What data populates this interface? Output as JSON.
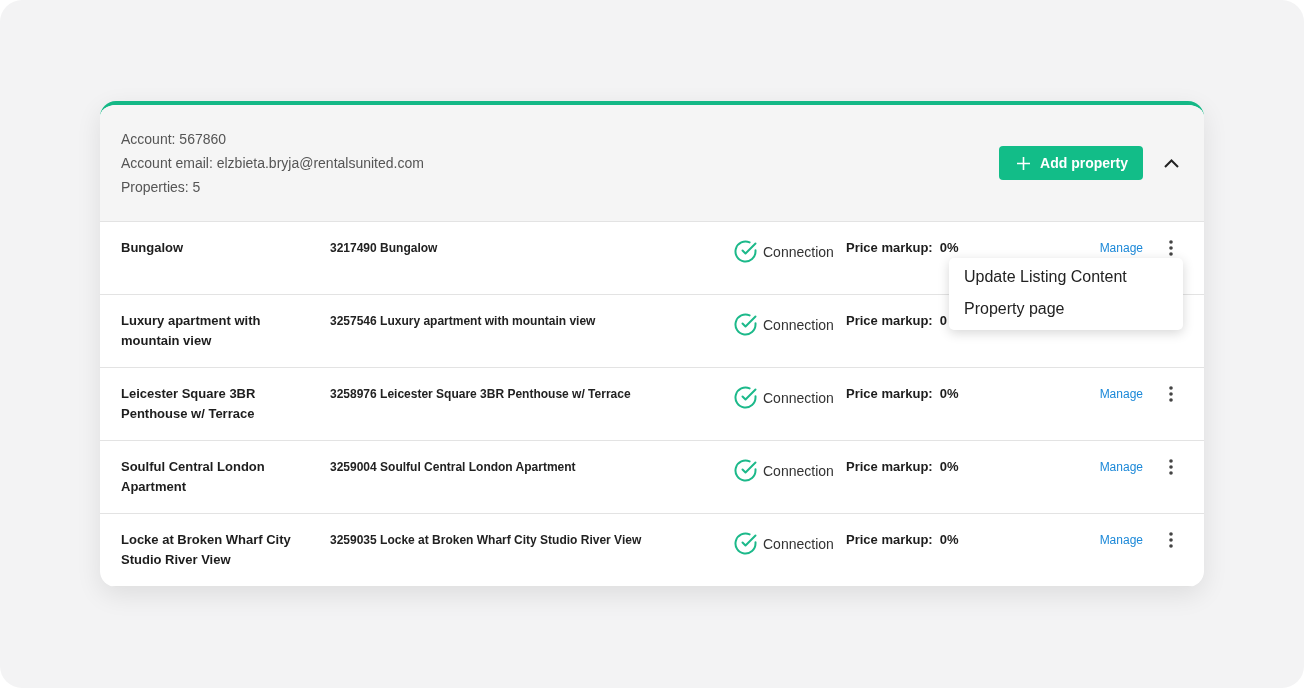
{
  "account": {
    "lines": [
      "Account: 567860",
      "Account email: elzbieta.bryja@rentalsunited.com",
      "Properties: 5"
    ],
    "add_button": "Add property",
    "expanded": true
  },
  "properties": [
    {
      "name": "Bungalow",
      "listing": "3217490 Bungalow",
      "connection": {
        "label": "Connection",
        "connected": true
      },
      "markup_label": "Price markup:",
      "markup_value": "0%",
      "manage": "Manage",
      "menu": {
        "items": [
          "Update Listing Content",
          "Property page"
        ]
      }
    },
    {
      "name": "Luxury apartment with mountain view",
      "listing": "3257546 Luxury apartment with mountain view",
      "connection": {
        "label": "Connection",
        "connected": true
      },
      "markup_label": "Price markup:",
      "markup_value": "0"
    },
    {
      "name": "Leicester Square 3BR Penthouse w/ Terrace",
      "listing": "3258976 Leicester Square 3BR Penthouse w/ Terrace",
      "connection": {
        "label": "Connection",
        "connected": true
      },
      "markup_label": "Price markup:",
      "markup_value": "0%",
      "manage": "Manage"
    },
    {
      "name": "Soulful Central London Apartment",
      "listing": "3259004 Soulful Central London Apartment",
      "connection": {
        "label": "Connection",
        "connected": true
      },
      "markup_label": "Price markup:",
      "markup_value": "0%",
      "manage": "Manage"
    },
    {
      "name": "Locke at Broken Wharf City Studio River View",
      "listing": "3259035 Locke at Broken Wharf City Studio River View",
      "connection": {
        "label": "Connection",
        "connected": true
      },
      "markup_label": "Price markup:",
      "markup_value": "0%",
      "manage": "Manage"
    }
  ]
}
